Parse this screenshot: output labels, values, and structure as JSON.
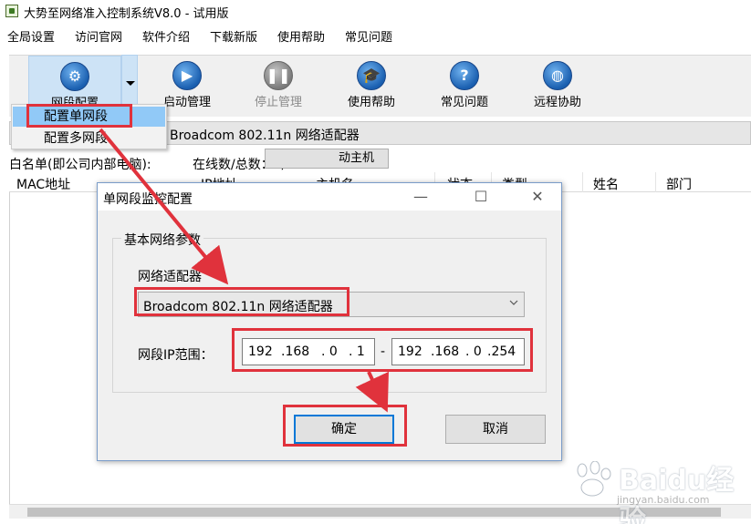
{
  "window": {
    "title": "大势至网络准入控制系统V8.0 - 试用版"
  },
  "menu": [
    "全局设置",
    "访问官网",
    "软件介绍",
    "下载新版",
    "使用帮助",
    "常见问题"
  ],
  "toolbar": {
    "buttons": [
      {
        "label": "网段配置",
        "icon": "gear-icon"
      },
      {
        "label": "启动管理",
        "icon": "play-icon"
      },
      {
        "label": "停止管理",
        "icon": "pause-icon"
      },
      {
        "label": "使用帮助",
        "icon": "graduation-cap-icon"
      },
      {
        "label": "常见问题",
        "icon": "question-icon"
      },
      {
        "label": "远程协助",
        "icon": "globe-icon"
      }
    ]
  },
  "dropdown_menu": {
    "items": [
      "配置单网段",
      "配置多网段"
    ],
    "selected": "配置单网段"
  },
  "adapter_bar": {
    "text": "Broadcom 802.11n 网络适配器"
  },
  "partial_button": {
    "label": "动主机"
  },
  "status": {
    "whitelist": "白名单(即公司内部电脑):",
    "online": "在线数/总数：0/0"
  },
  "table": {
    "columns": [
      "MAC地址",
      "IP地址",
      "主机名",
      "状态",
      "类型",
      "姓名",
      "部门"
    ]
  },
  "dialog": {
    "title": "单网段监控配置",
    "group_title": "基本网络参数",
    "adapter_label": "网络适配器",
    "adapter_value": "Broadcom 802.11n 网络适配器",
    "ip_label": "网段IP范围：",
    "ip_start": [
      "192",
      ".168",
      ". 0",
      ". 1"
    ],
    "ip_separator": "-",
    "ip_end": [
      "192",
      ".168",
      ". 0",
      ".254"
    ],
    "ok_label": "确定",
    "cancel_label": "取消"
  },
  "watermark": {
    "brand": "Baidu经验",
    "url": "jingyan.baidu.com"
  },
  "colors": {
    "highlight": "#e0323c",
    "selection": "#91c9f7",
    "toolbar_active": "#cde3f6"
  }
}
